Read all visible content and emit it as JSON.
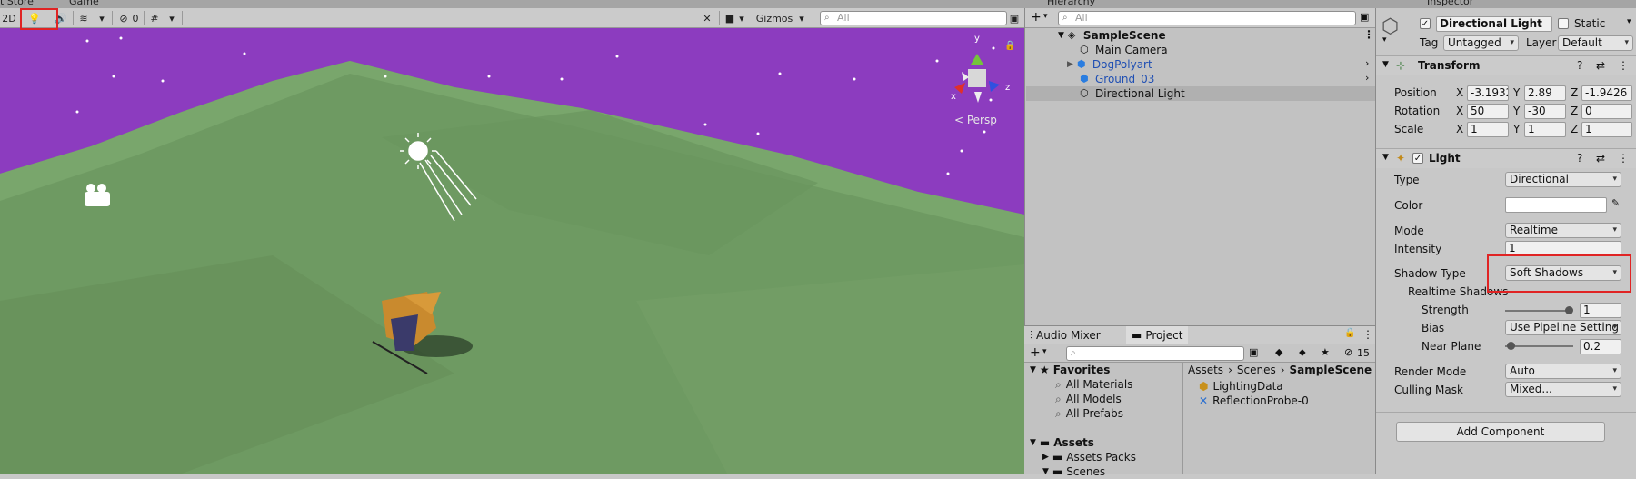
{
  "top_tabs": {
    "asset_store": "t Store",
    "game": "Game",
    "hierarchy": "Hierarchy",
    "inspector": "Inspector"
  },
  "scene_toolbar": {
    "mode_2d": "2D",
    "hidden_count": "0",
    "gizmos_label": "Gizmos",
    "search_placeholder": "All",
    "persp_label": "< Persp"
  },
  "gizmo_axes": {
    "y": "y",
    "x": "x",
    "z": "z"
  },
  "hierarchy": {
    "search_placeholder": "All",
    "scene_name": "SampleScene",
    "items": [
      {
        "label": "Main Camera",
        "prefab": false
      },
      {
        "label": "DogPolyart",
        "prefab": true
      },
      {
        "label": "Ground_03",
        "prefab": true
      },
      {
        "label": "Directional Light",
        "prefab": false,
        "selected": true
      }
    ]
  },
  "project": {
    "tabs": [
      "Audio Mixer",
      "Project"
    ],
    "hidden_count": "15",
    "favorites_label": "Favorites",
    "favorites": [
      "All Materials",
      "All Models",
      "All Prefabs"
    ],
    "assets_label": "Assets",
    "asset_folders": [
      "Assets Packs",
      "Scenes"
    ],
    "breadcrumb": [
      "Assets",
      "Scenes",
      "SampleScene"
    ],
    "files": [
      "LightingData",
      "ReflectionProbe-0"
    ]
  },
  "inspector": {
    "object_name": "Directional Light",
    "static_label": "Static",
    "tag_label": "Tag",
    "tag_value": "Untagged",
    "layer_label": "Layer",
    "layer_value": "Default",
    "transform": {
      "title": "Transform",
      "rows": [
        {
          "label": "Position",
          "x": "-3.1932",
          "y": "2.89",
          "z": "-1.9426"
        },
        {
          "label": "Rotation",
          "x": "50",
          "y": "-30",
          "z": "0"
        },
        {
          "label": "Scale",
          "x": "1",
          "y": "1",
          "z": "1"
        }
      ]
    },
    "light": {
      "title": "Light",
      "type_label": "Type",
      "type_value": "Directional",
      "color_label": "Color",
      "mode_label": "Mode",
      "mode_value": "Realtime",
      "intensity_label": "Intensity",
      "intensity_value": "1",
      "shadow_type_label": "Shadow Type",
      "shadow_type_value": "Soft Shadows",
      "realtime_shadows_label": "Realtime Shadows",
      "strength_label": "Strength",
      "strength_value": "1",
      "bias_label": "Bias",
      "bias_value": "Use Pipeline Setting",
      "near_plane_label": "Near Plane",
      "near_plane_value": "0.2",
      "render_mode_label": "Render Mode",
      "render_mode_value": "Auto",
      "culling_mask_label": "Culling Mask",
      "culling_mask_value": "Mixed..."
    },
    "add_component": "Add Component"
  },
  "colors": {
    "sky": "#8c3cbf",
    "ground": "#6e9a62",
    "highlight": "#e02424",
    "selected_row": "#b0b0b0"
  }
}
